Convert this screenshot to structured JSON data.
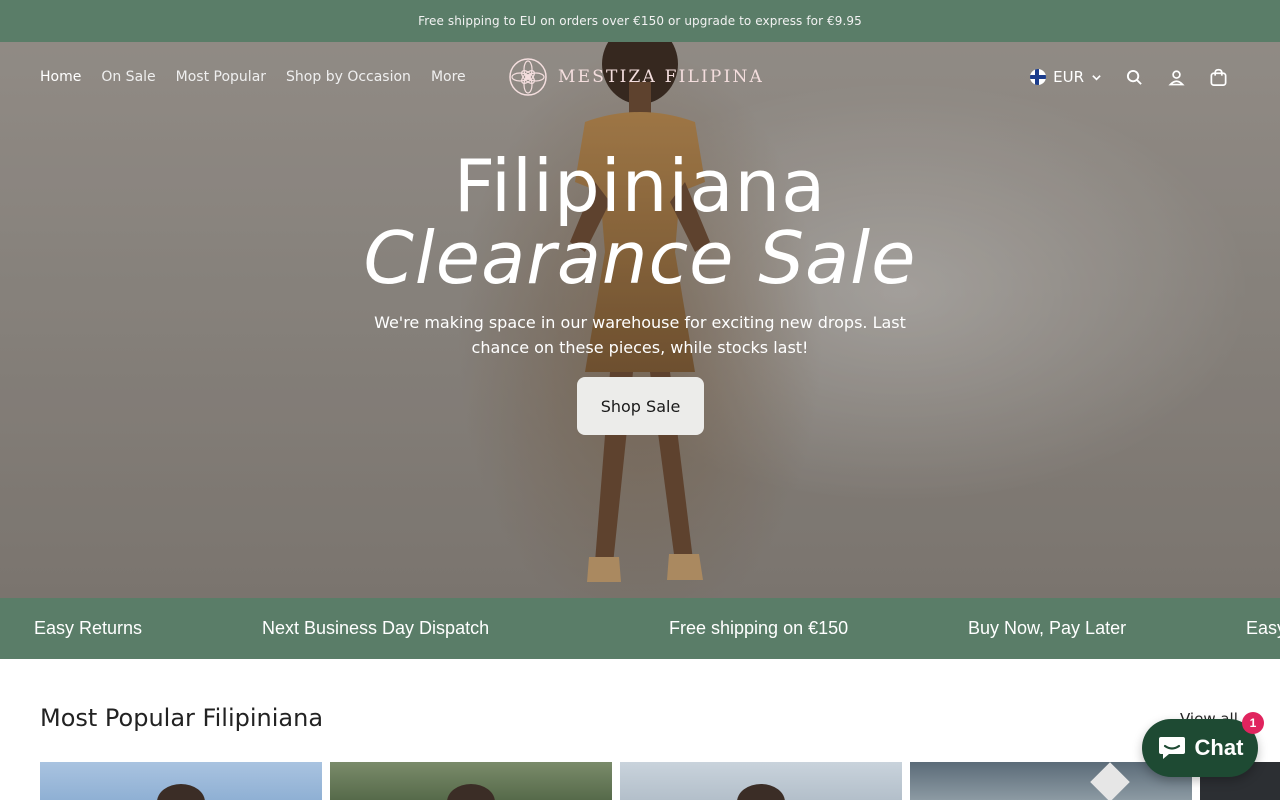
{
  "announcement": {
    "text": "Free shipping to EU on orders over €150 or upgrade to express for €9.95"
  },
  "header": {
    "nav": [
      {
        "label": "Home"
      },
      {
        "label": "On Sale"
      },
      {
        "label": "Most Popular"
      },
      {
        "label": "Shop by Occasion"
      },
      {
        "label": "More"
      }
    ],
    "logo": {
      "text": "MESTIZA FILIPINA",
      "icon": "lotus-logo-icon"
    },
    "currency": {
      "code": "EUR",
      "flag": "finland-flag-icon"
    },
    "icons": [
      "search-icon",
      "account-icon",
      "bag-icon"
    ]
  },
  "hero": {
    "title_line1": "Filipiniana",
    "title_line2": "Clearance Sale",
    "subtitle": "We're making space in our warehouse for exciting new drops. Last chance on these pieces, while stocks last!",
    "cta_label": "Shop Sale"
  },
  "usp_bar": {
    "items": [
      "Easy Returns",
      "Next Business Day Dispatch",
      "Free shipping on €150",
      "Buy Now, Pay Later",
      "Easy"
    ]
  },
  "most_popular": {
    "title": "Most Popular Filipiniana",
    "view_all_label": "View all",
    "cards": [
      {
        "name": "product-card-1"
      },
      {
        "name": "product-card-2"
      },
      {
        "name": "product-card-3"
      },
      {
        "name": "product-card-4"
      }
    ]
  },
  "chat": {
    "label": "Chat",
    "badge_count": "1"
  },
  "colors": {
    "accent_green": "#5a7d68",
    "chat_green": "#1e4a33",
    "badge_red": "#e0245e",
    "logo_pink": "#f4dede"
  }
}
